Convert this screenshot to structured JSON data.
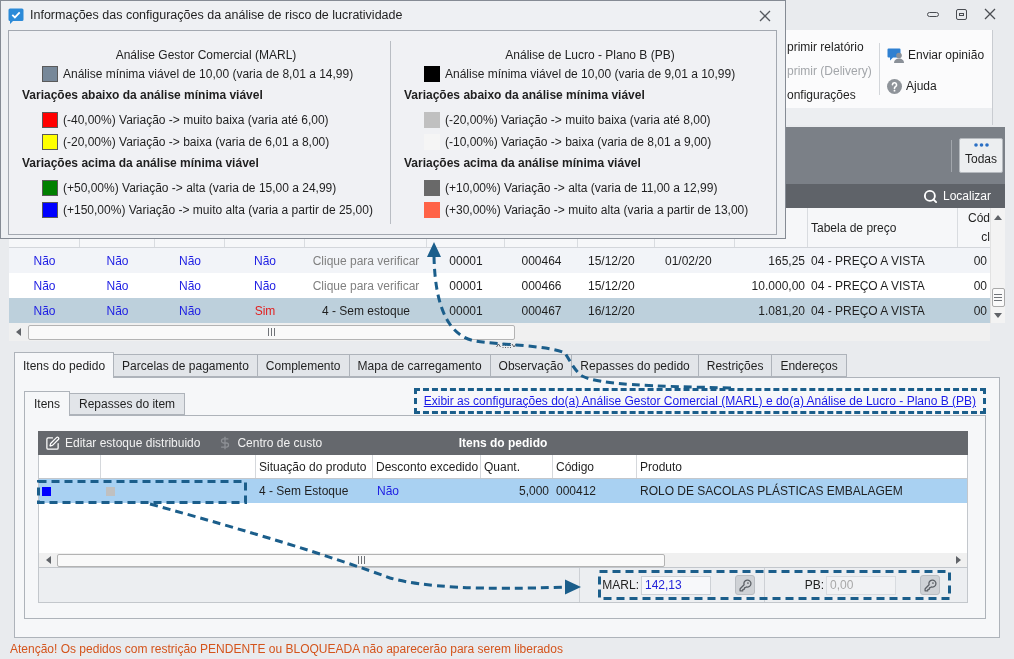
{
  "dialog": {
    "title": "Informações das configurações da análise de risco de lucratividade",
    "columns": [
      {
        "title": "Análise Gestor Comercial (MARL)",
        "outlined": true,
        "baseline": {
          "color": "#778899",
          "text": "Análise mínima viável de 10,00 (varia de 8,01 a 14,99)"
        },
        "groups": [
          {
            "heading": "Variações abaixo da análise mínima viável",
            "items": [
              {
                "color": "#ff0000",
                "text": "(-40,00%) Variação -> muito baixa (varia até 6,00)"
              },
              {
                "color": "#ffff00",
                "text": "(-20,00%) Variação -> baixa (varia de 6,01 a 8,00)"
              }
            ]
          },
          {
            "heading": "Variações acima da análise mínima viável",
            "items": [
              {
                "color": "#008000",
                "text": "(+50,00%) Variação -> alta (varia de 15,00 a 24,99)"
              },
              {
                "color": "#0000ff",
                "text": "(+150,00%) Variação -> muito alta (varia a partir de 25,00)"
              }
            ]
          }
        ]
      },
      {
        "title": "Análise de Lucro - Plano B (PB)",
        "outlined": false,
        "baseline": {
          "color": "#000000",
          "text": "Análise mínima viável de 10,00 (varia de 9,01 a 10,99)"
        },
        "groups": [
          {
            "heading": "Variações abaixo da análise mínima viável",
            "items": [
              {
                "color": "#c0c0c0",
                "text": "(-20,00%) Variação -> muito baixa (varia até 8,00)"
              },
              {
                "color": "#f5f5f5",
                "text": "(-10,00%) Variação -> baixa (varia de 8,01 a 9,00)"
              }
            ]
          },
          {
            "heading": "Variações acima da análise mínima viável",
            "items": [
              {
                "color": "#696969",
                "text": "(+10,00%) Variação -> alta (varia de 11,00 a 12,99)"
              },
              {
                "color": "#ff6347",
                "text": "(+30,00%) Variação -> muito alta (varia a partir de 13,00)"
              }
            ]
          }
        ]
      }
    ]
  },
  "ribbon": {
    "commands": [
      {
        "label": "primir relatório",
        "disabled": false
      },
      {
        "label": "primir (Delivery)",
        "disabled": true
      },
      {
        "label": "onfigurações",
        "disabled": false
      }
    ],
    "links": [
      {
        "label": "Enviar opinião"
      },
      {
        "label": "Ajuda"
      }
    ]
  },
  "filter_bar": {
    "button": "Todas"
  },
  "search_bar": {
    "button": "Localizar"
  },
  "orders_table": {
    "columns": [
      "",
      "",
      "",
      "",
      "",
      "",
      "",
      "",
      "",
      "",
      "Tabela de preço",
      "Cód cl"
    ],
    "rows": [
      {
        "selected": false,
        "cells": [
          {
            "kind": "flag",
            "alert": false,
            "text": "Não"
          },
          {
            "kind": "flag",
            "alert": false,
            "text": "Não"
          },
          {
            "kind": "flag",
            "alert": false,
            "text": "Não"
          },
          {
            "kind": "flag",
            "alert": false,
            "text": "Não"
          },
          {
            "kind": "prompt",
            "text": "Clique para verificar"
          },
          {
            "kind": "code",
            "text": "00001"
          },
          {
            "kind": "code",
            "text": "000464"
          },
          {
            "kind": "date",
            "text": "15/12/20"
          },
          {
            "kind": "date",
            "text": "01/02/20"
          },
          {
            "kind": "number",
            "text": "165,25"
          },
          {
            "kind": "text",
            "text": "04 - PREÇO A VISTA"
          },
          {
            "kind": "number",
            "text": "00"
          }
        ]
      },
      {
        "selected": false,
        "cells": [
          {
            "kind": "flag",
            "alert": false,
            "text": "Não"
          },
          {
            "kind": "flag",
            "alert": false,
            "text": "Não"
          },
          {
            "kind": "flag",
            "alert": false,
            "text": "Não"
          },
          {
            "kind": "flag",
            "alert": false,
            "text": "Não"
          },
          {
            "kind": "prompt",
            "text": "Clique para verificar"
          },
          {
            "kind": "code",
            "text": "00001"
          },
          {
            "kind": "code",
            "text": "000466"
          },
          {
            "kind": "date",
            "text": "15/12/20"
          },
          {
            "kind": "blank"
          },
          {
            "kind": "number",
            "text": "10.000,00"
          },
          {
            "kind": "text",
            "text": "04 - PREÇO A VISTA"
          },
          {
            "kind": "number",
            "text": "00"
          }
        ]
      },
      {
        "selected": true,
        "cells": [
          {
            "kind": "flag",
            "alert": false,
            "text": "Não"
          },
          {
            "kind": "flag",
            "alert": false,
            "text": "Não"
          },
          {
            "kind": "flag",
            "alert": false,
            "text": "Não"
          },
          {
            "kind": "flag",
            "alert": true,
            "text": "Sim"
          },
          {
            "kind": "status",
            "text": "4 - Sem estoque"
          },
          {
            "kind": "code",
            "text": "00001"
          },
          {
            "kind": "code",
            "text": "000467"
          },
          {
            "kind": "date",
            "text": "16/12/20"
          },
          {
            "kind": "blank"
          },
          {
            "kind": "number",
            "text": "1.081,20"
          },
          {
            "kind": "text",
            "text": "04 - PREÇO A VISTA"
          },
          {
            "kind": "number",
            "text": "00"
          }
        ]
      }
    ]
  },
  "tabs": [
    {
      "label": "Itens do pedido",
      "selected": true
    },
    {
      "label": "Parcelas de pagamento",
      "selected": false
    },
    {
      "label": "Complemento",
      "selected": false
    },
    {
      "label": "Mapa de carregamento",
      "selected": false
    },
    {
      "label": "Observação",
      "selected": false
    },
    {
      "label": "Repasses do pedido",
      "selected": false
    },
    {
      "label": "Restrições",
      "selected": false
    },
    {
      "label": "Endereços",
      "selected": false
    }
  ],
  "subtabs": [
    {
      "label": "Itens",
      "selected": true
    },
    {
      "label": "Repasses do item",
      "selected": false
    }
  ],
  "settings_link": "Exibir as configurações do(a) Análise Gestor Comercial (MARL) e do(a) Análise de Lucro - Plano B (PB)",
  "items_grid": {
    "toolbar": [
      {
        "label": "Editar estoque distribuido"
      },
      {
        "label": "Centro de custo"
      }
    ],
    "title": "Itens do pedido",
    "columns": [
      {
        "label": "Situação do produto"
      },
      {
        "label": "Desconto excedido"
      },
      {
        "label": "Quant."
      },
      {
        "label": "Código"
      },
      {
        "label": "Produto"
      }
    ],
    "rows": [
      {
        "selected": true,
        "markers": [
          {
            "color": "#0000ff"
          },
          {
            "color": "#c0c0c0"
          }
        ],
        "cells": [
          {
            "kind": "status",
            "text": "4 - Sem Estoque"
          },
          {
            "kind": "flag",
            "alert": false,
            "text": "Não"
          },
          {
            "kind": "number",
            "text": "5,000"
          },
          {
            "kind": "code",
            "text": "000412"
          },
          {
            "kind": "text",
            "text": "ROLO DE SACOLAS PLÁSTICAS EMBALAGEM"
          }
        ]
      }
    ]
  },
  "analysis_fields": [
    {
      "label": "MARL:",
      "value": "142,13",
      "disabled": false
    },
    {
      "label": "PB:",
      "value": "0,00",
      "disabled": true
    }
  ],
  "status_message": "Atenção! Os pedidos com restrição PENDENTE ou BLOQUEADA não aparecerão para serem liberados"
}
